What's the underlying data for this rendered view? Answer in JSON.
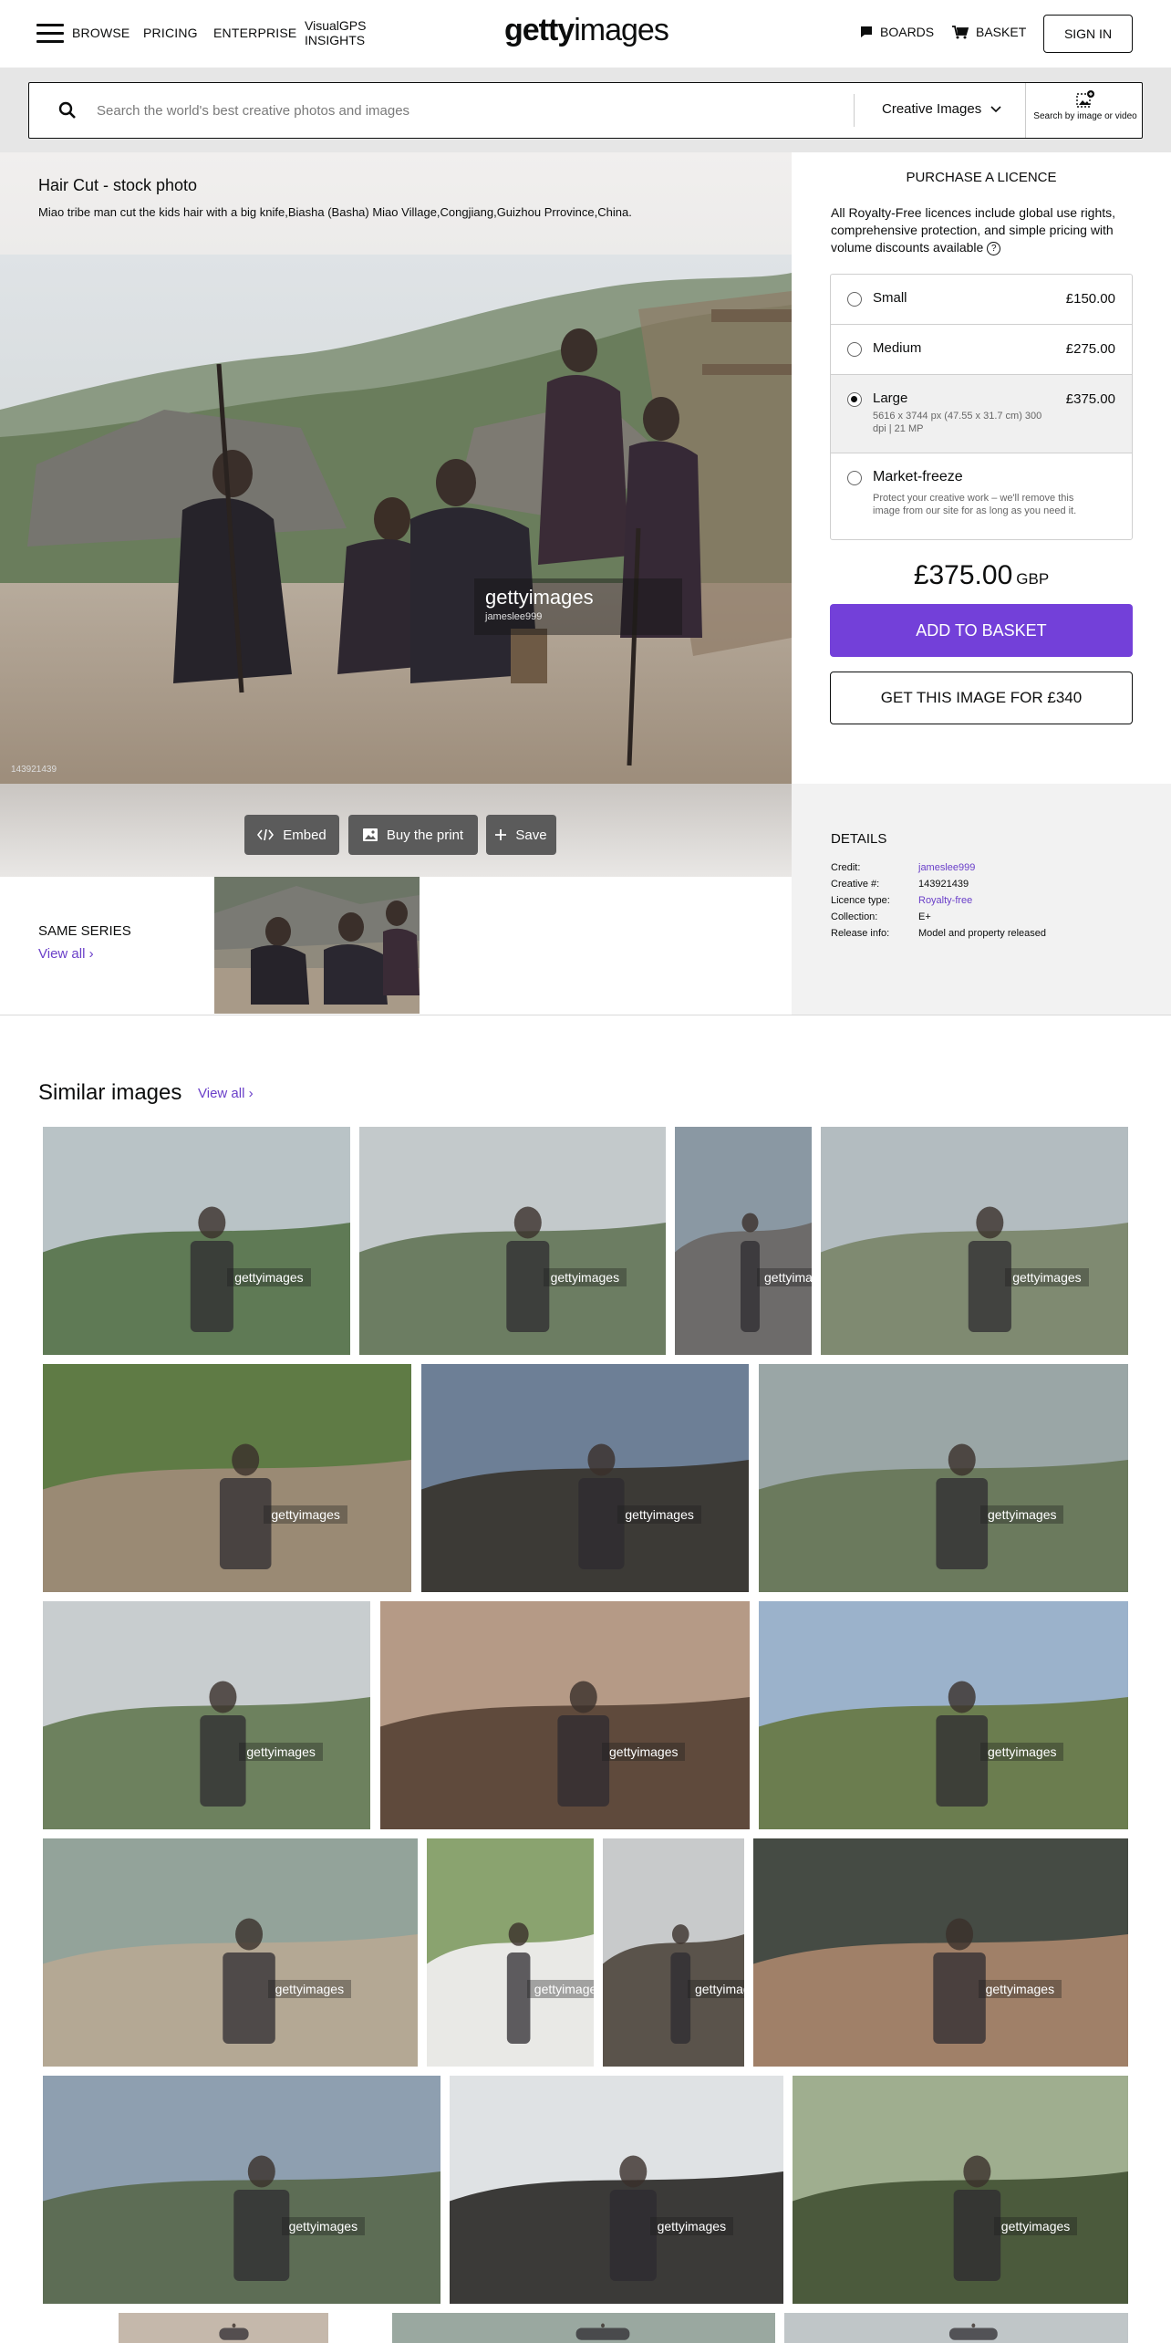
{
  "header": {
    "nav": [
      "BROWSE",
      "PRICING",
      "ENTERPRISE"
    ],
    "visualgps": "VisualGPS INSIGHTS",
    "logo_bold": "getty",
    "logo_light": "images",
    "boards": "BOARDS",
    "basket": "BASKET",
    "signin": "SIGN IN"
  },
  "search": {
    "placeholder": "Search the world's best creative photos and images",
    "type_label": "Creative Images",
    "by_image": "Search by image or video"
  },
  "photo": {
    "title": "Hair Cut - stock photo",
    "caption": "Miao tribe man cut the kids hair with a big knife,Biasha (Basha) Miao Village,Congjiang,Guizhou Prrovince,China.",
    "watermark_brand": "gettyimages",
    "watermark_credit": "jameslee999",
    "id": "143921439",
    "actions": [
      "Embed",
      "Buy the print",
      "Save"
    ]
  },
  "same_series": {
    "heading": "SAME SERIES",
    "view_all": "View all"
  },
  "purchase": {
    "title": "PURCHASE A LICENCE",
    "description": "All Royalty-Free licences include global use rights, comprehensive protection, and simple pricing with volume discounts available",
    "options": [
      {
        "name": "Small",
        "price": "£150.00",
        "detail": "",
        "selected": false
      },
      {
        "name": "Medium",
        "price": "£275.00",
        "detail": "",
        "selected": false
      },
      {
        "name": "Large",
        "price": "£375.00",
        "detail": "5616 x 3744 px (47.55 x 31.7 cm) 300 dpi | 21 MP",
        "selected": true
      },
      {
        "name": "Market-freeze",
        "price": "",
        "detail": "Protect your creative work – we'll remove this image from our site for as long as you need it.",
        "selected": false
      }
    ],
    "total_price": "£375.00",
    "currency": "GBP",
    "add_to_basket": "ADD TO BASKET",
    "get_image": "GET THIS IMAGE FOR £340"
  },
  "details": {
    "heading": "DETAILS",
    "rows": [
      {
        "key": "Credit:",
        "value": "jameslee999",
        "link": true
      },
      {
        "key": "Creative #:",
        "value": "143921439",
        "link": false
      },
      {
        "key": "Licence type:",
        "value": "Royalty-free",
        "link": true
      },
      {
        "key": "Collection:",
        "value": "E+",
        "link": false
      },
      {
        "key": "Release info:",
        "value": "Model and property released",
        "link": false
      }
    ]
  },
  "similar": {
    "heading": "Similar images",
    "view_all": "View all",
    "watermark": "gettyimages"
  },
  "colors": {
    "accent": "#7340d9",
    "link": "#6a3fc9"
  }
}
